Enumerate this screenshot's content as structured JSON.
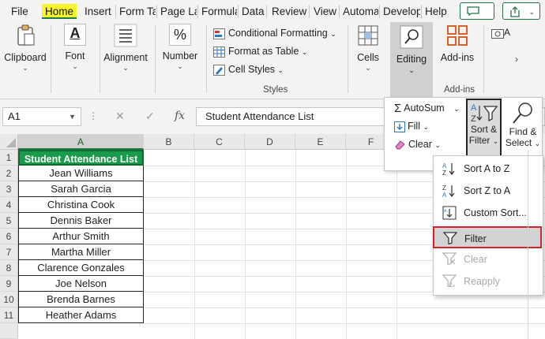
{
  "tabs": [
    {
      "label": "File"
    },
    {
      "label": "Home",
      "active": true
    },
    {
      "label": "Insert"
    },
    {
      "label": "Form Ta"
    },
    {
      "label": "Page La"
    },
    {
      "label": "Formula"
    },
    {
      "label": "Data"
    },
    {
      "label": "Review"
    },
    {
      "label": "View"
    },
    {
      "label": "Automa"
    },
    {
      "label": "Develop"
    },
    {
      "label": "Help"
    }
  ],
  "ribbon": {
    "clipboard": "Clipboard",
    "font": "Font",
    "alignment": "Alignment",
    "number": "Number",
    "conditional_formatting": "Conditional Formatting",
    "format_as_table": "Format as Table",
    "cell_styles": "Cell Styles",
    "styles_group": "Styles",
    "cells": "Cells",
    "editing": "Editing",
    "addins": "Add-ins",
    "addins_group": "Add-ins",
    "font_glyph": "A",
    "number_glyph": "%",
    "partial_label": "A"
  },
  "formula_bar": {
    "name_box": "A1",
    "formula": "Student Attendance List",
    "fx": "fx"
  },
  "grid": {
    "columns": [
      "A",
      "B",
      "C",
      "D",
      "E",
      "F"
    ],
    "rows": [
      "1",
      "2",
      "3",
      "4",
      "5",
      "6",
      "7",
      "8",
      "9",
      "10",
      "11"
    ],
    "cells": [
      "Student Attendance List",
      "Jean Williams",
      "Sarah Garcia",
      "Christina Cook",
      "Dennis Baker",
      "Arthur Smith",
      "Martha Miller",
      "Clarence Gonzales",
      "Joe Nelson",
      "Brenda Barnes",
      "Heather Adams"
    ]
  },
  "editing_panel": {
    "autosum": "AutoSum",
    "fill": "Fill",
    "clear": "Clear",
    "sort_filter_line1": "Sort &",
    "sort_filter_line2": "Filter",
    "find_select_line1": "Find &",
    "find_select_line2": "Select"
  },
  "sort_filter_menu": [
    {
      "label": "Sort A to Z",
      "icon": "sort-a-z-icon"
    },
    {
      "label": "Sort Z to A",
      "icon": "sort-z-a-icon"
    },
    {
      "label": "Custom Sort...",
      "icon": "custom-sort-icon"
    },
    {
      "label": "Filter",
      "icon": "filter-icon",
      "highlighted": true
    },
    {
      "label": "Clear",
      "icon": "clear-filter-icon",
      "disabled": true
    },
    {
      "label": "Reapply",
      "icon": "reapply-icon",
      "disabled": true
    }
  ],
  "colors": {
    "accent": "#217346",
    "header_fill": "#1a9a4b",
    "highlight_tab": "#f6f62a",
    "menu_highlight_border": "#d8202a"
  }
}
